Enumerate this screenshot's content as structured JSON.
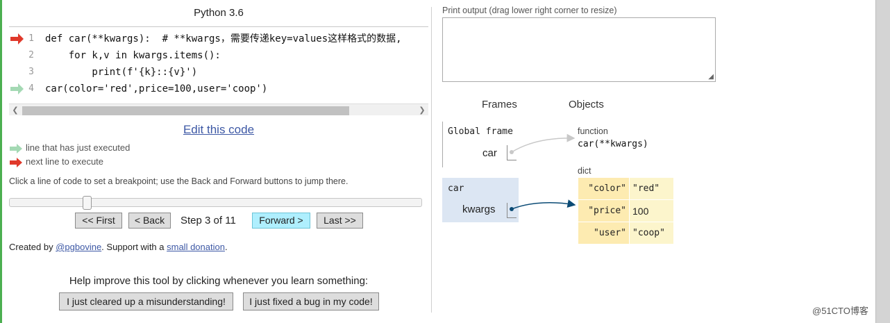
{
  "header": {
    "language": "Python 3.6"
  },
  "code_lines": [
    {
      "num": "1",
      "text": "def car(**kwargs):  # **kwargs，需要传递key=values这样格式的数据,",
      "marker": "next"
    },
    {
      "num": "2",
      "text": "    for k,v in kwargs.items():",
      "marker": "none"
    },
    {
      "num": "3",
      "text": "        print(f'{k}::{v}')",
      "marker": "none"
    },
    {
      "num": "4",
      "text": "car(color='red',price=100,user='coop')",
      "marker": "executed"
    }
  ],
  "edit_link": "Edit this code",
  "legend": {
    "executed": "line that has just executed",
    "next": "next line to execute"
  },
  "hint": "Click a line of code to set a breakpoint; use the Back and Forward buttons to jump there.",
  "slider": {
    "step": 3,
    "total": 11
  },
  "nav": {
    "first": "<< First",
    "back": "< Back",
    "step_text": "Step 3 of 11",
    "forward": "Forward >",
    "last": "Last >>"
  },
  "credits": {
    "prefix": "Created by ",
    "author": "@pgbovine",
    "middle": ". Support with a ",
    "donation": "small donation",
    "suffix": "."
  },
  "help": {
    "text": "Help improve this tool by clicking whenever you learn something:",
    "btn_misunderstanding": "I just cleared up a misunderstanding!",
    "btn_bug": "I just fixed a bug in my code!"
  },
  "output": {
    "label": "Print output (drag lower right corner to resize)",
    "content": ""
  },
  "viz": {
    "frames_header": "Frames",
    "objects_header": "Objects",
    "global_frame": {
      "title": "Global frame",
      "var": "car"
    },
    "car_frame": {
      "title": "car",
      "var": "kwargs"
    },
    "function_obj": {
      "type_label": "function",
      "name": "car(**kwargs)"
    },
    "dict_obj": {
      "type_label": "dict",
      "entries": [
        {
          "key": "\"color\"",
          "value": "\"red\""
        },
        {
          "key": "\"price\"",
          "value": "100"
        },
        {
          "key": "\"user\"",
          "value": "\"coop\""
        }
      ]
    }
  },
  "watermark": "@51CTO博客",
  "colors": {
    "next_arrow": "#e0392b",
    "executed_arrow": "#a4d9b4",
    "forward_button": "#afeffe",
    "pointer": "#0b4b75",
    "frame_active": "#dce6f3",
    "dict_key": "#fdebb1",
    "dict_value": "#fcf5cc",
    "link": "#3d58a5"
  }
}
